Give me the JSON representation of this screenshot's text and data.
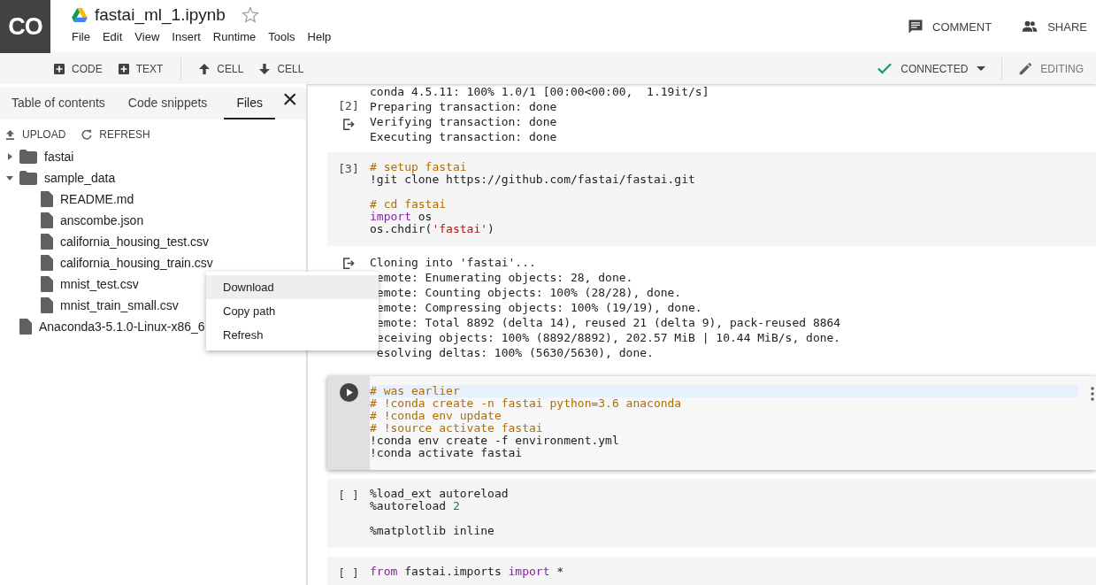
{
  "header": {
    "logo": "CO",
    "title": "fastai_ml_1.ipynb",
    "starred": false,
    "menu": [
      "File",
      "Edit",
      "View",
      "Insert",
      "Runtime",
      "Tools",
      "Help"
    ],
    "actions": [
      {
        "kind": "comment",
        "label": "COMMENT"
      },
      {
        "kind": "share",
        "label": "SHARE"
      }
    ]
  },
  "toolbar": {
    "buttons": [
      {
        "kind": "add",
        "label": "CODE"
      },
      {
        "kind": "add",
        "label": "TEXT"
      },
      {
        "kind": "up",
        "label": "CELL"
      },
      {
        "kind": "down",
        "label": "CELL"
      }
    ],
    "status": {
      "label": "CONNECTED",
      "connected": true
    },
    "mode": {
      "label": "EDITING"
    }
  },
  "sidebar": {
    "tabs": [
      {
        "label": "Table of contents",
        "selected": false
      },
      {
        "label": "Code snippets",
        "selected": false
      },
      {
        "label": "Files",
        "selected": true
      }
    ],
    "close": "×",
    "actions": [
      {
        "kind": "upload",
        "label": "UPLOAD"
      },
      {
        "kind": "refresh",
        "label": "REFRESH"
      }
    ],
    "files": [
      {
        "name": "fastai",
        "kind": "folder",
        "expanded": false
      },
      {
        "name": "sample_data",
        "kind": "folder",
        "expanded": true,
        "children": [
          {
            "name": "README.md",
            "kind": "file"
          },
          {
            "name": "anscombe.json",
            "kind": "file"
          },
          {
            "name": "california_housing_test.csv",
            "kind": "file"
          },
          {
            "name": "california_housing_train.csv",
            "kind": "file"
          },
          {
            "name": "mnist_test.csv",
            "kind": "file"
          },
          {
            "name": "mnist_train_small.csv",
            "kind": "file"
          }
        ]
      },
      {
        "name": "Anaconda3-5.1.0-Linux-x86_6",
        "kind": "file"
      }
    ],
    "context_menu": [
      {
        "label": "Download",
        "selected": true
      },
      {
        "label": "Copy path",
        "selected": false
      },
      {
        "label": "Refresh",
        "selected": false
      }
    ]
  },
  "cells": [
    {
      "kind": "output-only",
      "prompt": "[2]",
      "active": false,
      "output": [
        {
          "kind": "line",
          "text": "conda 4.5.11: 100% 1.0/1 [00:00<00:00,  1.19it/s]"
        },
        {
          "kind": "line",
          "text": "Preparing transaction: done"
        },
        {
          "kind": "line",
          "text": "Verifying transaction: done"
        },
        {
          "kind": "line",
          "text": "Executing transaction: done"
        }
      ]
    },
    {
      "kind": "code",
      "prompt": "[3]",
      "active": false,
      "code": [
        [
          {
            "kind": "comment",
            "text": "# setup fastai"
          }
        ],
        [
          {
            "kind": "plain",
            "text": "!git clone https://github.com/fastai/fastai.git"
          }
        ],
        [
          {
            "kind": "blank"
          }
        ],
        [
          {
            "kind": "comment",
            "text": "# cd fastai"
          }
        ],
        [
          {
            "kind": "keyword",
            "text": "import"
          },
          {
            "kind": "plain",
            "text": " os"
          }
        ],
        [
          {
            "kind": "plain",
            "text": "os.chdir("
          },
          {
            "kind": "string",
            "text": "'fastai'"
          },
          {
            "kind": "plain",
            "text": ")"
          }
        ]
      ],
      "output": [
        {
          "kind": "line",
          "text": "Cloning into 'fastai'..."
        },
        {
          "kind": "covered",
          "text": "emote: Enumerating objects: 28, done."
        },
        {
          "kind": "covered",
          "text": "emote: Counting objects: 100% (28/28), done."
        },
        {
          "kind": "covered",
          "text": "emote: Compressing objects: 100% (19/19), done."
        },
        {
          "kind": "covered",
          "text": "emote: Total 8892 (delta 14), reused 21 (delta 9), pack-reused 8864"
        },
        {
          "kind": "covered",
          "text": "eceiving objects: 100% (8892/8892), 202.57 MiB | 10.44 MiB/s, done."
        },
        {
          "kind": "covered",
          "text": "esolving deltas: 100% (5630/5630), done."
        }
      ]
    },
    {
      "kind": "code",
      "active": true,
      "code": [
        [
          {
            "kind": "comment",
            "text": "# was earlier"
          }
        ],
        [
          {
            "kind": "comment",
            "text": "# !conda create -n fastai python=3.6 anaconda"
          }
        ],
        [
          {
            "kind": "comment",
            "text": "# !conda env update"
          }
        ],
        [
          {
            "kind": "comment",
            "text": "# !source activate fastai"
          }
        ],
        [
          {
            "kind": "plain",
            "text": "!conda env create -f environment.yml"
          }
        ],
        [
          {
            "kind": "plain",
            "text": "!conda activate fastai"
          }
        ]
      ]
    },
    {
      "kind": "code",
      "prompt": "[ ]",
      "active": false,
      "code": [
        [
          {
            "kind": "plain",
            "text": "%load_ext autoreload"
          }
        ],
        [
          {
            "kind": "plain",
            "text": "%autoreload "
          },
          {
            "kind": "number",
            "text": "2"
          }
        ],
        [
          {
            "kind": "blank"
          }
        ],
        [
          {
            "kind": "plain",
            "text": "%matplotlib inline"
          }
        ]
      ]
    },
    {
      "kind": "code",
      "prompt": "[ ]",
      "active": false,
      "code": [
        [
          {
            "kind": "keyword",
            "text": "from"
          },
          {
            "kind": "plain",
            "text": " fastai.imports "
          },
          {
            "kind": "keyword",
            "text": "import"
          },
          {
            "kind": "plain",
            "text": " *"
          }
        ]
      ]
    }
  ]
}
